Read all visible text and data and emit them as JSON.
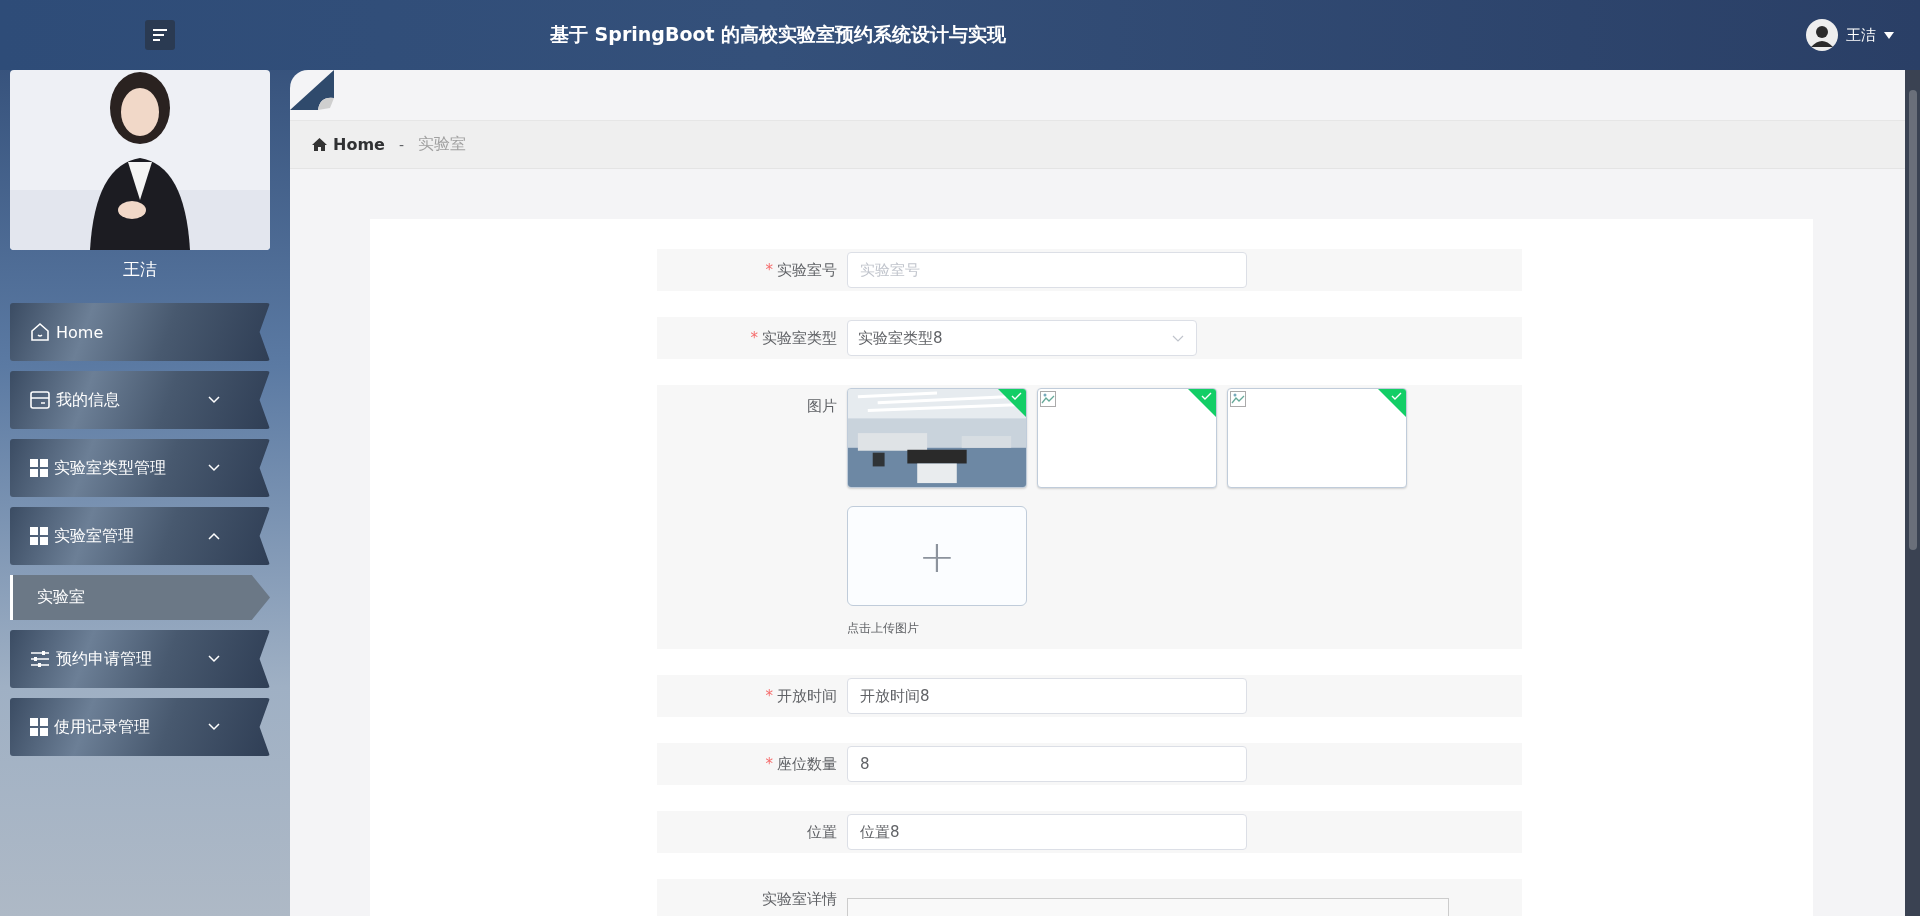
{
  "header": {
    "title": "基于 SpringBoot 的高校实验室预约系统设计与实现",
    "user": "王洁"
  },
  "sidebar": {
    "profile_name": "王洁",
    "items": [
      {
        "kind": "link",
        "label": "Home"
      },
      {
        "kind": "group",
        "label": "我的信息",
        "expanded": false
      },
      {
        "kind": "group",
        "label": "实验室类型管理",
        "expanded": false
      },
      {
        "kind": "group",
        "label": "实验室管理",
        "expanded": true,
        "children": [
          {
            "label": "实验室",
            "selected": true
          }
        ]
      },
      {
        "kind": "group",
        "label": "预约申请管理",
        "expanded": false
      },
      {
        "kind": "group",
        "label": "使用记录管理",
        "expanded": false
      }
    ]
  },
  "breadcrumb": {
    "home": "Home",
    "separator": "-",
    "current": "实验室"
  },
  "form": {
    "required_mark": "*",
    "fields": [
      {
        "kind": "input",
        "label": "实验室号",
        "required": true,
        "placeholder": "实验室号"
      },
      {
        "kind": "select",
        "label": "实验室类型",
        "required": true,
        "value": "实验室类型8"
      },
      {
        "kind": "upload",
        "label": "图片",
        "required": false,
        "images": [
          {
            "kind": "picture"
          },
          {
            "kind": "broken"
          },
          {
            "kind": "broken"
          }
        ],
        "add": "+",
        "hint": "点击上传图片"
      },
      {
        "kind": "input",
        "label": "开放时间",
        "required": true,
        "value": "开放时间8"
      },
      {
        "kind": "input",
        "label": "座位数量",
        "required": true,
        "value": "8"
      },
      {
        "kind": "input",
        "label": "位置",
        "required": false,
        "value": "位置8"
      },
      {
        "kind": "editor",
        "label": "实验室详情",
        "required": false
      }
    ]
  }
}
